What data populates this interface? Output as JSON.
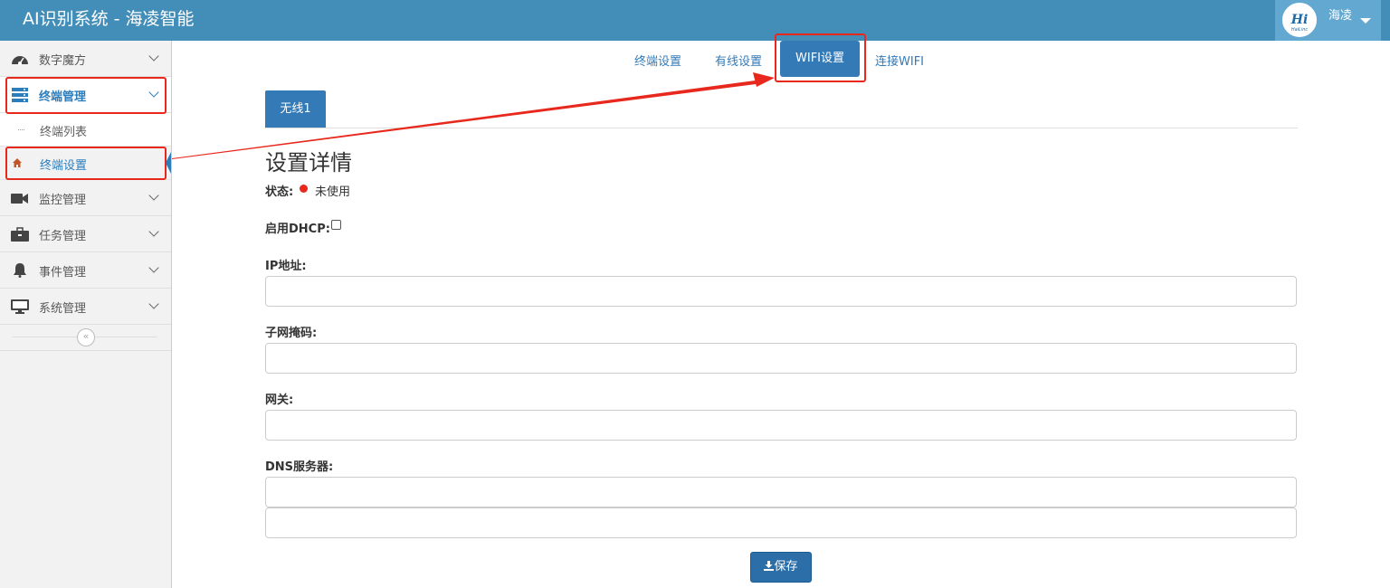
{
  "header": {
    "title": "AI识别系统 - 海凌智能",
    "user_name": "海凌",
    "logo_text": "HaiLinc"
  },
  "sidebar": {
    "items": [
      {
        "label": "数字魔方",
        "icon": "dashboard-icon"
      },
      {
        "label": "终端管理",
        "icon": "server-icon"
      },
      {
        "label": "监控管理",
        "icon": "video-camera-icon"
      },
      {
        "label": "任务管理",
        "icon": "briefcase-icon"
      },
      {
        "label": "事件管理",
        "icon": "bell-icon"
      },
      {
        "label": "系统管理",
        "icon": "desktop-icon"
      }
    ],
    "sub_items": [
      {
        "label": "终端列表"
      },
      {
        "label": "终端设置"
      }
    ],
    "collapse_glyph": "«"
  },
  "top_tabs": {
    "terminal": "终端设置",
    "wired": "有线设置",
    "wifi": "WIFI设置",
    "connect": "连接WIFI"
  },
  "form": {
    "wireless_tab": "无线1",
    "title": "设置详情",
    "status_label": "状态:",
    "status_value": "未使用",
    "dhcp_label": "启用DHCP:",
    "ip_label": "IP地址:",
    "mask_label": "子网掩码:",
    "gateway_label": "网关:",
    "dns_label": "DNS服务器:",
    "ip_value": "",
    "mask_value": "",
    "gateway_value": "",
    "dns1_value": "",
    "dns2_value": "",
    "save_label": "保存"
  },
  "colors": {
    "header": "#438eb9",
    "primary": "#337ab7",
    "annotation": "#e8281c",
    "status_dot": "#e8281c"
  }
}
